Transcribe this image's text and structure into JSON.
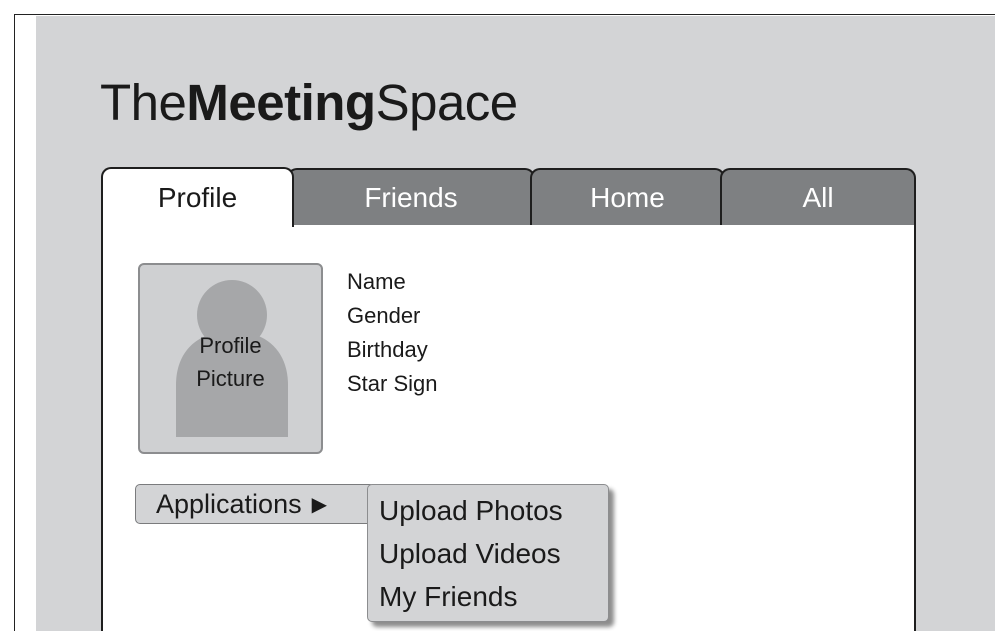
{
  "logo": {
    "part1": "The",
    "part2": "Meeting",
    "part3": "Space"
  },
  "tabs": [
    {
      "label": "Profile",
      "active": true
    },
    {
      "label": "Friends",
      "active": false
    },
    {
      "label": "Home",
      "active": false
    },
    {
      "label": "All",
      "active": false
    }
  ],
  "profile": {
    "picture_label_line1": "Profile",
    "picture_label_line2": "Picture",
    "fields": [
      "Name",
      "Gender",
      "Birthday",
      "Star Sign"
    ]
  },
  "applications": {
    "label": "Applications",
    "arrow_icon": "triangle-right-icon",
    "menu_items": [
      "Upload Photos",
      "Upload Videos",
      "My Friends"
    ]
  },
  "colors": {
    "page_background": "#d3d4d6",
    "active_tab": "#ffffff",
    "inactive_tab": "#7e8082",
    "border": "#1e1e1e"
  }
}
